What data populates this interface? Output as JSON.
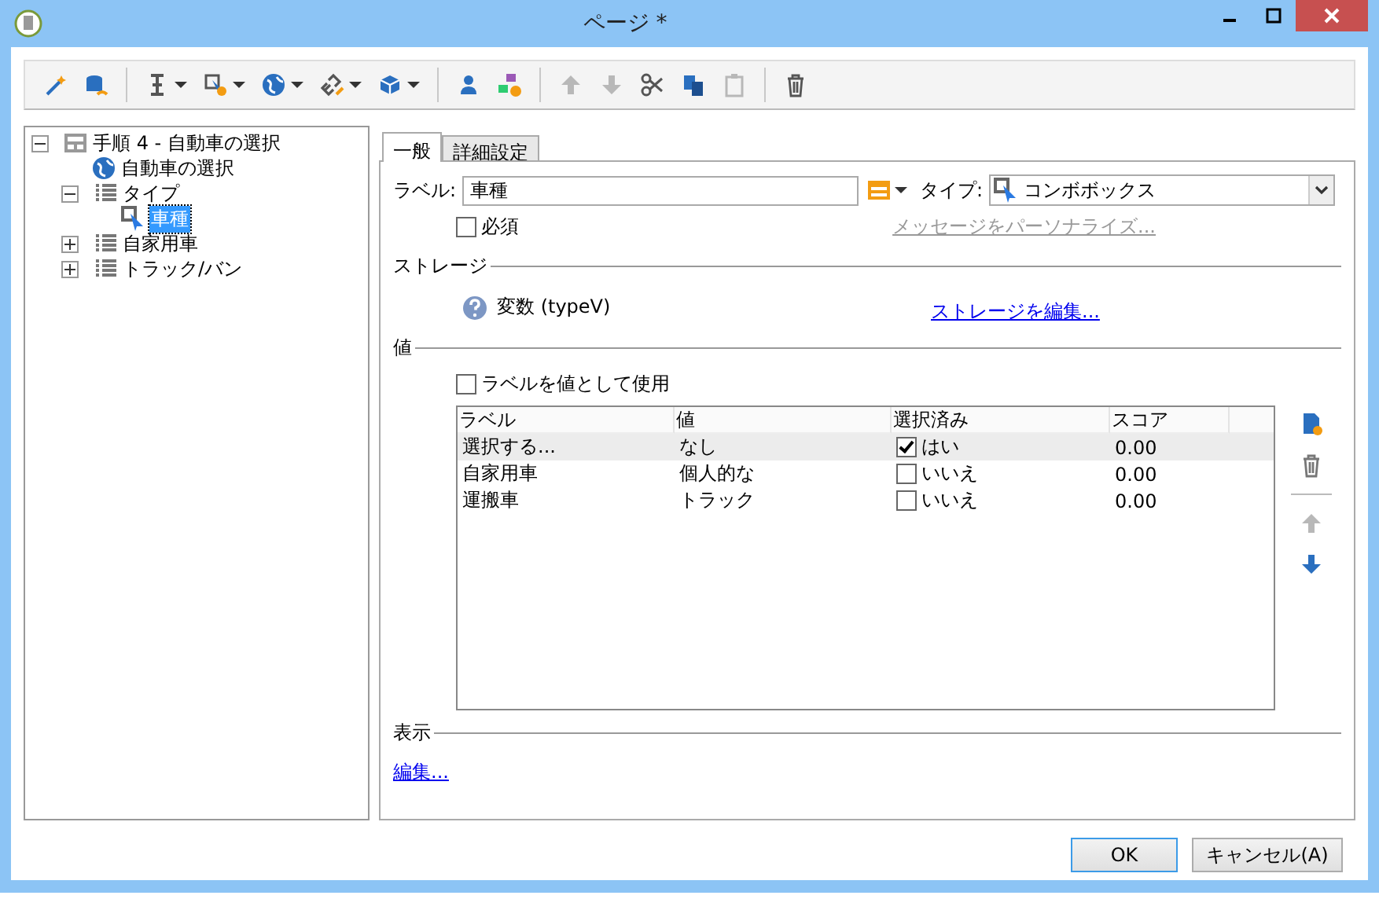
{
  "window": {
    "title": "ページ *"
  },
  "toolbar": [
    {
      "kind": "wand",
      "dropdown": false,
      "disabled": false
    },
    {
      "kind": "database",
      "dropdown": false,
      "disabled": false
    },
    {
      "kind": "separator"
    },
    {
      "kind": "text-cursor",
      "dropdown": true,
      "disabled": false
    },
    {
      "kind": "cursor-gear",
      "dropdown": true,
      "disabled": false
    },
    {
      "kind": "globe",
      "dropdown": true,
      "disabled": false
    },
    {
      "kind": "link",
      "dropdown": true,
      "disabled": false
    },
    {
      "kind": "box",
      "dropdown": true,
      "disabled": false
    },
    {
      "kind": "separator"
    },
    {
      "kind": "person",
      "dropdown": false,
      "disabled": false
    },
    {
      "kind": "shapes",
      "dropdown": false,
      "disabled": false
    },
    {
      "kind": "separator"
    },
    {
      "kind": "up",
      "dropdown": false,
      "disabled": true
    },
    {
      "kind": "down",
      "dropdown": false,
      "disabled": true
    },
    {
      "kind": "scissors",
      "dropdown": false,
      "disabled": false
    },
    {
      "kind": "copy",
      "dropdown": false,
      "disabled": false
    },
    {
      "kind": "paste",
      "dropdown": false,
      "disabled": true
    },
    {
      "kind": "separator"
    },
    {
      "kind": "trash",
      "dropdown": false,
      "disabled": false
    }
  ],
  "tree": [
    {
      "label": "手順 4 - 自動車の選択",
      "kind": "form",
      "expanded": true,
      "selected": false,
      "children": [
        {
          "label": "自動車の選択",
          "kind": "globe",
          "selected": false
        },
        {
          "label": "タイプ",
          "kind": "list",
          "expanded": true,
          "selected": false,
          "children": [
            {
              "label": "車種",
              "kind": "cursor",
              "selected": true
            }
          ]
        },
        {
          "label": "自家用車",
          "kind": "list",
          "expanded": false,
          "selected": false
        },
        {
          "label": "トラック/バン",
          "kind": "list",
          "expanded": false,
          "selected": false
        }
      ]
    }
  ],
  "tabs": [
    {
      "label": "一般",
      "selected": true
    },
    {
      "label": "詳細設定",
      "selected": false
    }
  ],
  "general": {
    "label_caption": "ラベル:",
    "label_value": "車種",
    "type_caption": "タイプ:",
    "type_value": "コンボボックス",
    "required": {
      "label": "必須",
      "checked": false
    },
    "personalize_link": {
      "label": "メッセージをパーソナライズ...",
      "disabled": true
    },
    "storage_heading": "ストレージ",
    "storage_variable": "変数 (typeV)",
    "storage_link": "ストレージを編集...",
    "values_heading": "値",
    "use_label": {
      "label": "ラベルを値として使用",
      "checked": false
    },
    "table": {
      "columns": [
        "ラベル",
        "値",
        "選択済み",
        "スコア"
      ],
      "rows": [
        {
          "label": "選択する...",
          "value": "なし",
          "checked": true,
          "choice": "はい",
          "score": "0.00",
          "selected": true
        },
        {
          "label": "自家用車",
          "value": "個人的な",
          "checked": false,
          "choice": "いいえ",
          "score": "0.00",
          "selected": false
        },
        {
          "label": "運搬車",
          "value": "トラック",
          "checked": false,
          "choice": "いいえ",
          "score": "0.00",
          "selected": false
        }
      ]
    },
    "side_buttons": [
      {
        "kind": "add",
        "disabled": false
      },
      {
        "kind": "delete",
        "disabled": false
      },
      {
        "kind": "separator"
      },
      {
        "kind": "up",
        "disabled": true
      },
      {
        "kind": "down",
        "disabled": false
      }
    ],
    "display_heading": "表示",
    "display_link": "編集..."
  },
  "buttons": [
    {
      "label": "OK",
      "default": true
    },
    {
      "label": "キャンセル(A)",
      "default": false
    }
  ]
}
